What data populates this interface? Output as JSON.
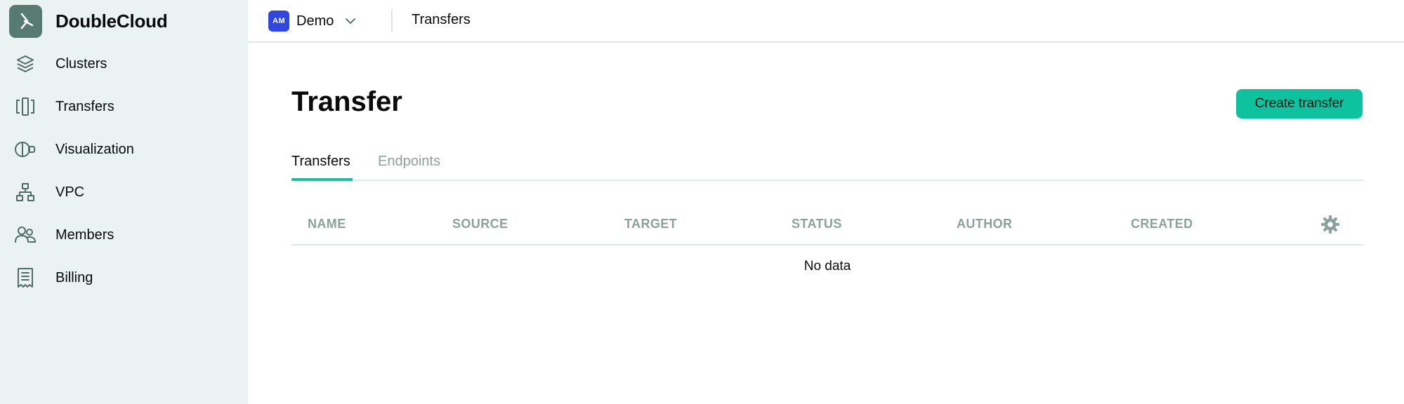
{
  "brand": {
    "name": "DoubleCloud",
    "logo_icon": "doublecloud-logo-icon"
  },
  "sidebar": {
    "items": [
      {
        "label": "Clusters",
        "icon": "layers-icon"
      },
      {
        "label": "Transfers",
        "icon": "transfer-icon"
      },
      {
        "label": "Visualization",
        "icon": "visualization-icon"
      },
      {
        "label": "VPC",
        "icon": "network-icon"
      },
      {
        "label": "Members",
        "icon": "members-icon"
      },
      {
        "label": "Billing",
        "icon": "receipt-icon"
      }
    ]
  },
  "topbar": {
    "org_initials": "AM",
    "org_name": "Demo",
    "breadcrumb": "Transfers"
  },
  "page": {
    "title": "Transfer",
    "create_button": "Create transfer",
    "tabs": [
      {
        "label": "Transfers",
        "active": true
      },
      {
        "label": "Endpoints",
        "active": false
      }
    ]
  },
  "table": {
    "columns": [
      "NAME",
      "SOURCE",
      "TARGET",
      "STATUS",
      "AUTHOR",
      "CREATED"
    ],
    "empty_text": "No data"
  },
  "colors": {
    "accent": "#0dc39f",
    "sidebar_bg": "#ebf2f2",
    "logo_bg": "#567b73",
    "org_avatar_bg": "#2f46e3",
    "muted_text": "#8ca19c"
  }
}
